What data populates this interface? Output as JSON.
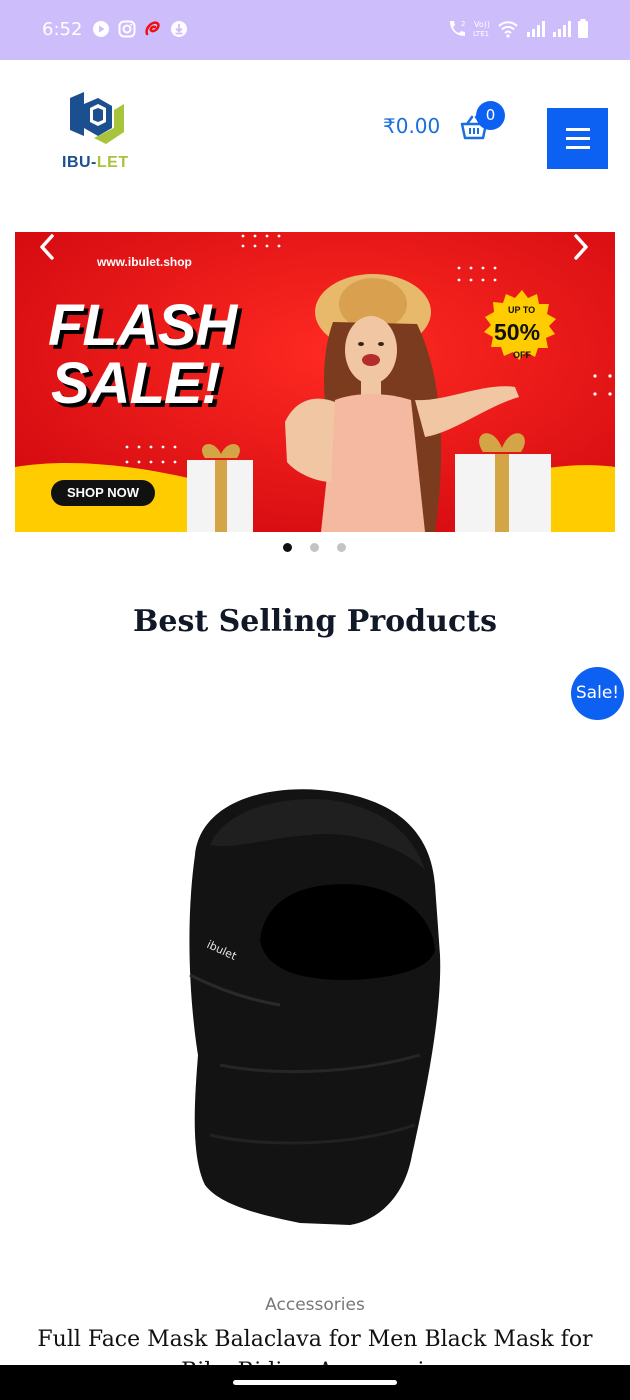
{
  "status_bar": {
    "time": "6:52",
    "left_icons": [
      "play-icon",
      "instagram-icon",
      "airtel-icon",
      "download-icon"
    ],
    "right_icons": [
      "volte-call-icon",
      "vo-lte-icon",
      "wifi-icon",
      "signal-icon",
      "signal-icon-2",
      "battery-icon"
    ],
    "background": "#cdbdfb",
    "vo_label": "Vo))",
    "lte_label": "LTE1"
  },
  "header": {
    "logo_text_part1": "IBU-",
    "logo_text_part2": "LET",
    "cart_total": "₹0.00",
    "cart_count": "0",
    "accent_color": "#0d61f2"
  },
  "banner": {
    "url": "www.ibulet.shop",
    "headline_line1": "FLASH",
    "headline_line2": "SALE!",
    "badge_up_to": "UP TO",
    "badge_percent": "50%",
    "badge_off": "OFF",
    "cta": "SHOP NOW",
    "active_slide": 1,
    "slide_count": 3
  },
  "section": {
    "title": "Best Selling Products"
  },
  "product": {
    "sale_label": "Sale!",
    "image_brand_text": "ibulet",
    "category": "Accessories",
    "title": "Full Face Mask Balaclava for Men Black Mask for Bike Riding Accessories"
  }
}
